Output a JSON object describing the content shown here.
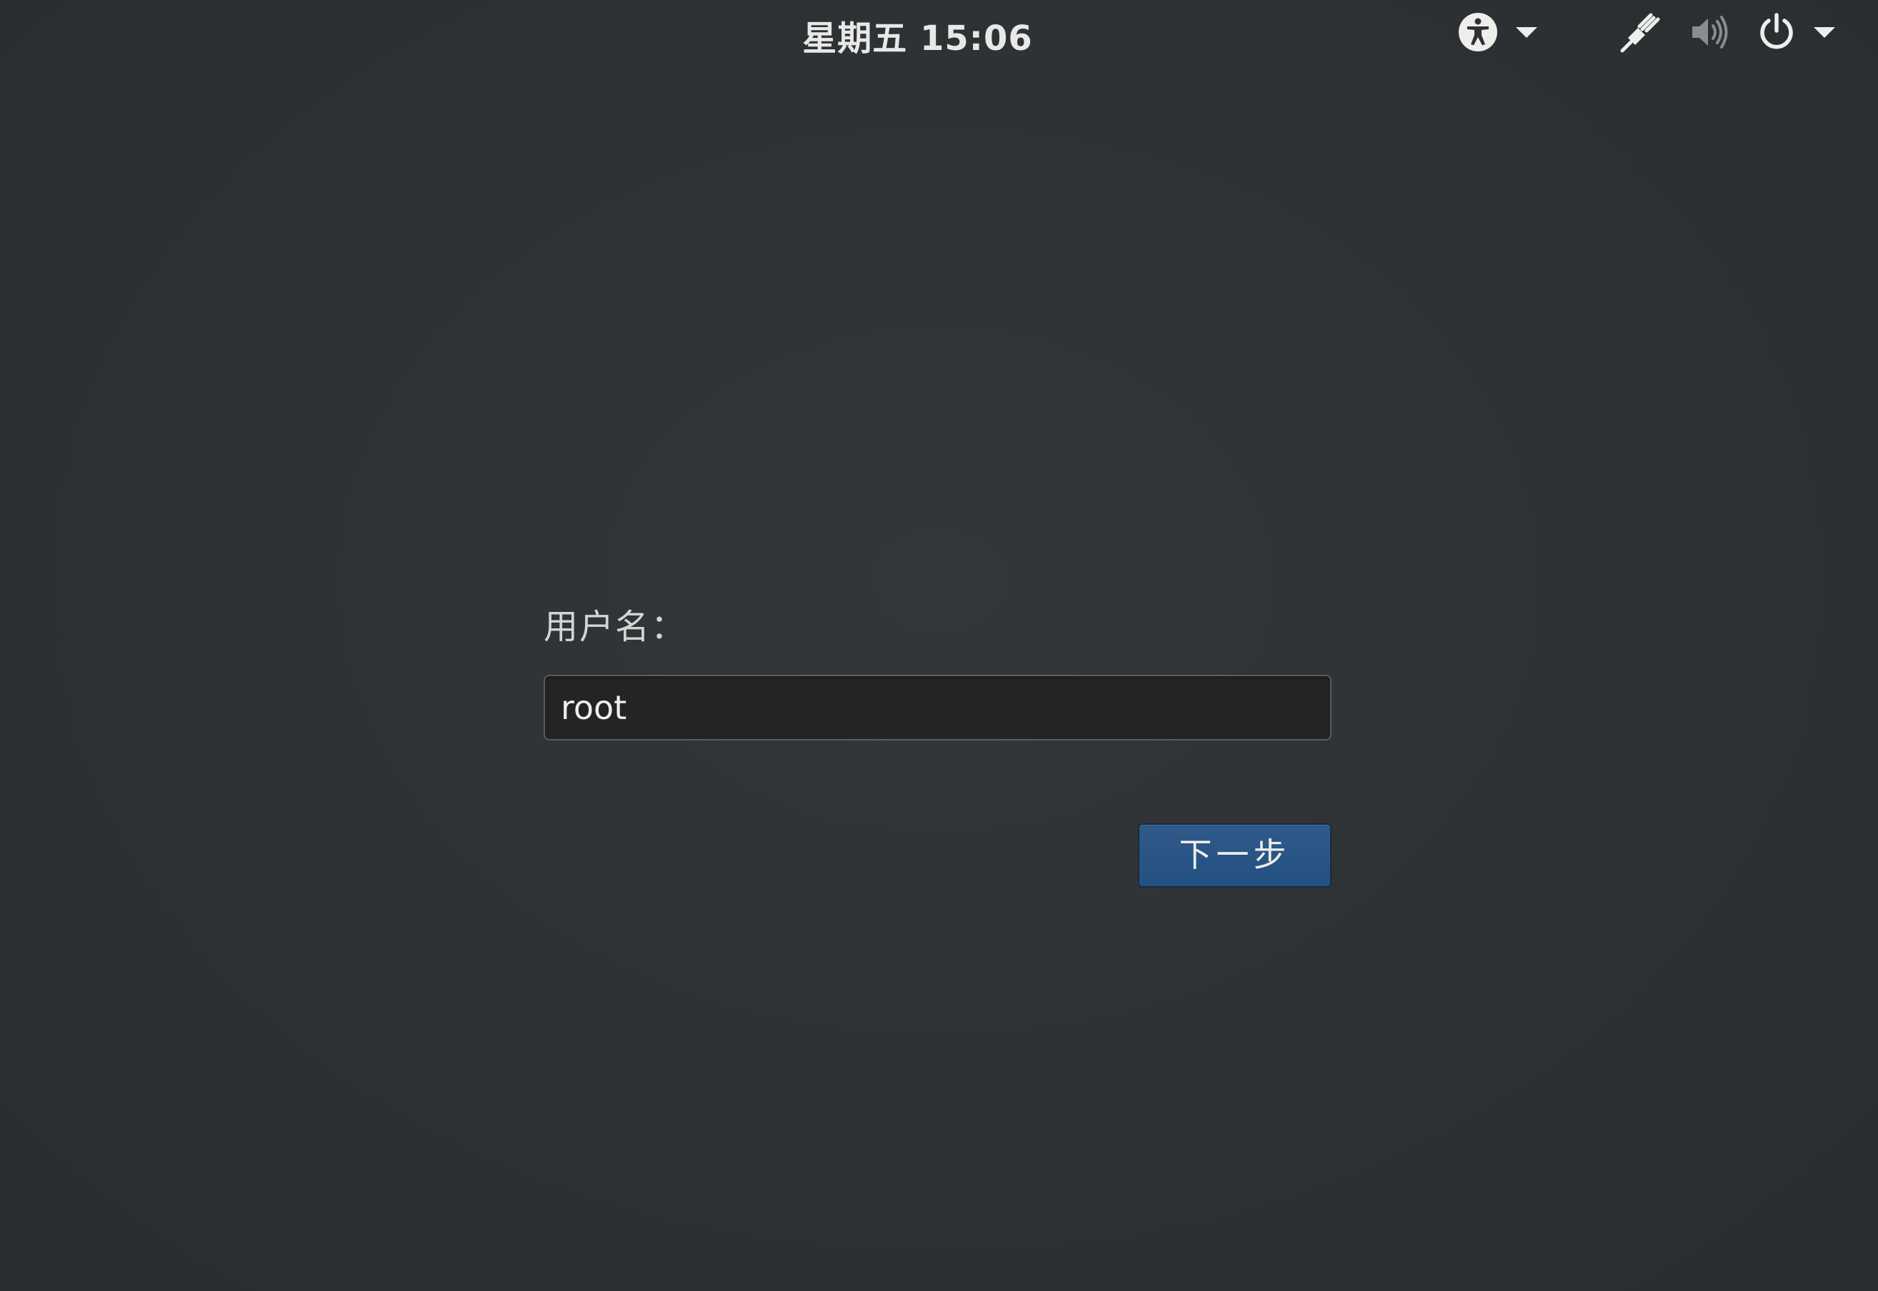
{
  "topbar": {
    "clock": "星期五 15:06",
    "icons": {
      "accessibility": "accessibility-icon",
      "accessibility_menu": "caret-down-icon",
      "network": "wired-network-icon",
      "volume": "volume-icon",
      "power": "power-icon",
      "system_menu": "caret-down-icon"
    }
  },
  "login": {
    "username_label": "用户名：",
    "username_value": "root",
    "next_label": "下一步"
  },
  "colors": {
    "background": "#2e3235",
    "button": "#2a5586",
    "text": "#eeeeec"
  }
}
